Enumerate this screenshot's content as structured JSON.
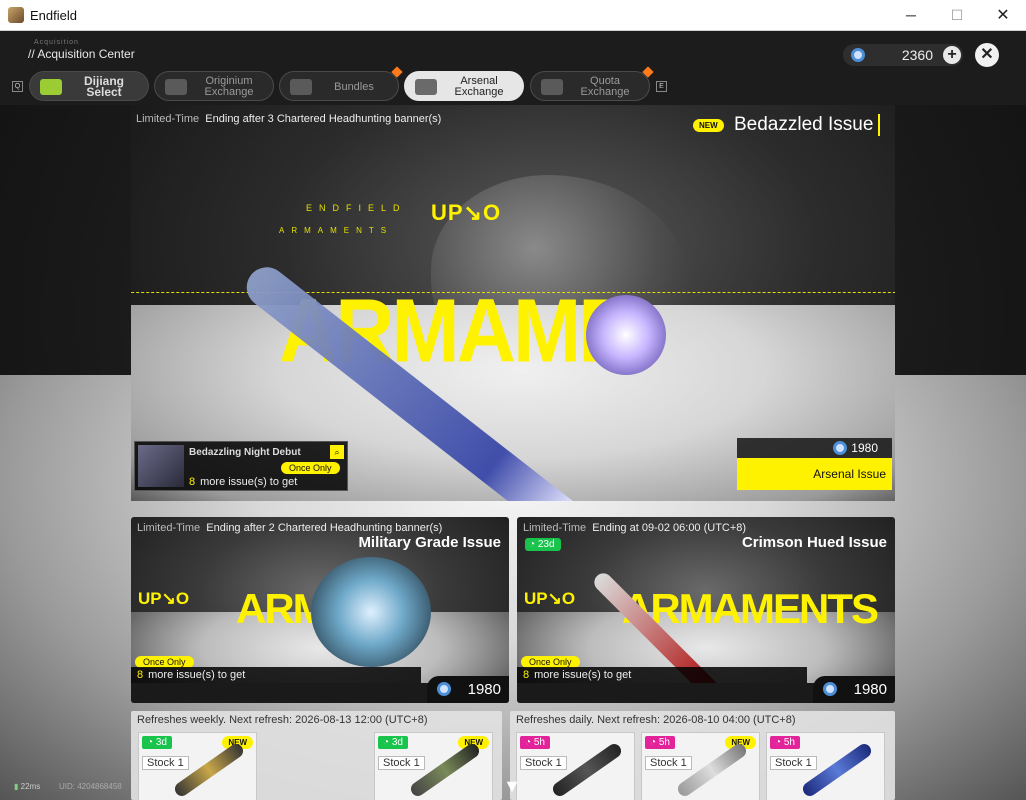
{
  "window": {
    "title": "Endfield",
    "minimize": "─",
    "maximize": "☐",
    "close": "✕"
  },
  "header": {
    "super": "Acquisition",
    "title": "// Acquisition Center",
    "currency_amount": "2360",
    "currency_plus": "+",
    "close": "✕"
  },
  "tabs": {
    "left_key": "Q",
    "right_key": "E",
    "items": [
      {
        "label": "Dijiang Select"
      },
      {
        "label": "Originium Exchange"
      },
      {
        "label": "Bundles"
      },
      {
        "label": "Arsenal Exchange"
      },
      {
        "label": "Quota Exchange"
      }
    ]
  },
  "hero": {
    "limited_label": "Limited-Time",
    "limited_text": "Ending after 3 Chartered Headhunting banner(s)",
    "new_badge": "NEW",
    "name": "Bedazzled Issue",
    "deco_top": "ENDFIELD",
    "deco_bottom": "ARMAMENTS",
    "up_text": "UP↘O",
    "big_text": "ARMAME",
    "item_title": "Bedazzling Night Debut",
    "item_search": "⌕",
    "once_only": "Once Only",
    "more_count": "8",
    "more_text": "more issue(s) to get",
    "price": "1980",
    "issue_type": "Arsenal Issue"
  },
  "banners": [
    {
      "limited_label": "Limited-Time",
      "limited_text": "Ending after 2 Chartered Headhunting banner(s)",
      "name": "Military Grade Issue",
      "up_text": "UP↘O",
      "big_text": "ARMAN",
      "once_only": "Once Only",
      "more_count": "8",
      "more_text": "more issue(s) to get",
      "price": "1980"
    },
    {
      "limited_label": "Limited-Time",
      "limited_text": "Ending at 09-02 06:00 (UTC+8)",
      "timer": "23d",
      "name": "Crimson Hued Issue",
      "up_text": "UP↘O",
      "big_text": "ARMAMENTS",
      "once_only": "Once Only",
      "more_count": "8",
      "more_text": "more issue(s) to get",
      "price": "1980"
    }
  ],
  "shop_weekly": {
    "refresh": "Refreshes weekly. Next refresh: 2026-08-13 12:00 (UTC+8)",
    "items": [
      {
        "timer": "3d",
        "stock": "Stock 1",
        "new": "NEW"
      },
      {
        "timer": "3d",
        "stock": "Stock 1",
        "new": "NEW"
      }
    ]
  },
  "shop_daily": {
    "refresh": "Refreshes daily. Next refresh: 2026-08-10 04:00 (UTC+8)",
    "items": [
      {
        "timer": "5h",
        "stock": "Stock 1",
        "new": ""
      },
      {
        "timer": "5h",
        "stock": "Stock 1",
        "new": "NEW"
      },
      {
        "timer": "5h",
        "stock": "Stock 1",
        "new": ""
      }
    ]
  },
  "footer": {
    "ping": "22ms",
    "uid": "UID: 4204868458"
  },
  "colors": {
    "accent": "#fff200",
    "timer_green": "#19c44d",
    "timer_pink": "#e3239a",
    "dot": "#ff7a1a"
  }
}
